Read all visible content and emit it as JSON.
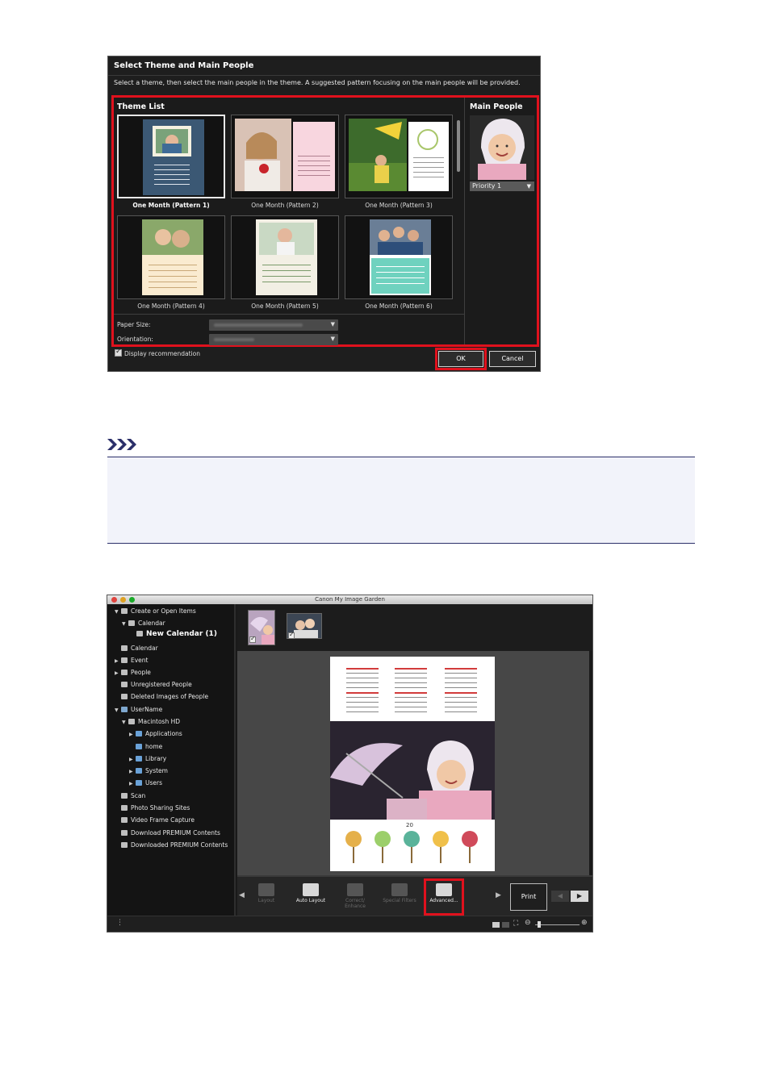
{
  "dialog": {
    "title": "Select Theme and Main People",
    "description": "Select a theme, then select the main people in the theme. A suggested pattern focusing on the main people will be provided.",
    "theme_list_label": "Theme List",
    "main_people_label": "Main People",
    "themes": [
      {
        "label": "One Month (Pattern 1)",
        "selected": true
      },
      {
        "label": "One Month (Pattern 2)",
        "selected": false
      },
      {
        "label": "One Month (Pattern 3)",
        "selected": false
      },
      {
        "label": "One Month (Pattern 4)",
        "selected": false
      },
      {
        "label": "One Month (Pattern 5)",
        "selected": false
      },
      {
        "label": "One Month (Pattern 6)",
        "selected": false
      }
    ],
    "priority": "Priority 1",
    "paper_size_label": "Paper Size:",
    "orientation_label": "Orientation:",
    "display_recommendation": "Display recommendation",
    "ok_label": "OK",
    "cancel_label": "Cancel",
    "highlight_color": "#e0111d"
  },
  "app": {
    "window_title": "Canon My Image Garden",
    "sidebar": [
      {
        "label": "Create or Open Items",
        "icon": "create-icon",
        "arrow": "▼"
      },
      {
        "label": "Calendar",
        "icon": "calendar-icon",
        "arrow": "▼"
      },
      {
        "label": "New Calendar (1)",
        "icon": "calendar-item-icon",
        "arrow": ""
      },
      {
        "label": "Calendar",
        "icon": "calendar-view-icon",
        "arrow": ""
      },
      {
        "label": "Event",
        "icon": "event-icon",
        "arrow": "▶"
      },
      {
        "label": "People",
        "icon": "people-icon",
        "arrow": "▶"
      },
      {
        "label": "Unregistered People",
        "icon": "unregistered-people-icon",
        "arrow": ""
      },
      {
        "label": "Deleted Images of People",
        "icon": "deleted-people-icon",
        "arrow": ""
      },
      {
        "label": "UserName",
        "icon": "computer-icon",
        "arrow": "▼"
      },
      {
        "label": "Macintosh HD",
        "icon": "disk-icon",
        "arrow": "▼"
      },
      {
        "label": "Applications",
        "icon": "folder-icon",
        "arrow": "▶"
      },
      {
        "label": "home",
        "icon": "home-icon",
        "arrow": ""
      },
      {
        "label": "Library",
        "icon": "folder-icon",
        "arrow": "▶"
      },
      {
        "label": "System",
        "icon": "folder-icon",
        "arrow": "▶"
      },
      {
        "label": "Users",
        "icon": "folder-icon",
        "arrow": "▶"
      },
      {
        "label": "Scan",
        "icon": "scan-icon",
        "arrow": ""
      },
      {
        "label": "Photo Sharing Sites",
        "icon": "photo-sharing-icon",
        "arrow": ""
      },
      {
        "label": "Video Frame Capture",
        "icon": "video-icon",
        "arrow": ""
      },
      {
        "label": "Download PREMIUM Contents",
        "icon": "download-icon",
        "arrow": ""
      },
      {
        "label": "Downloaded PREMIUM Contents",
        "icon": "downloaded-icon",
        "arrow": ""
      }
    ],
    "calendar_year_label": "20",
    "toolbar": {
      "layout": "Layout",
      "auto_layout": "Auto Layout",
      "correct_enhance": "Correct/ Enhance",
      "special_filters": "Special Filters",
      "advanced": "Advanced...",
      "print": "Print"
    }
  }
}
